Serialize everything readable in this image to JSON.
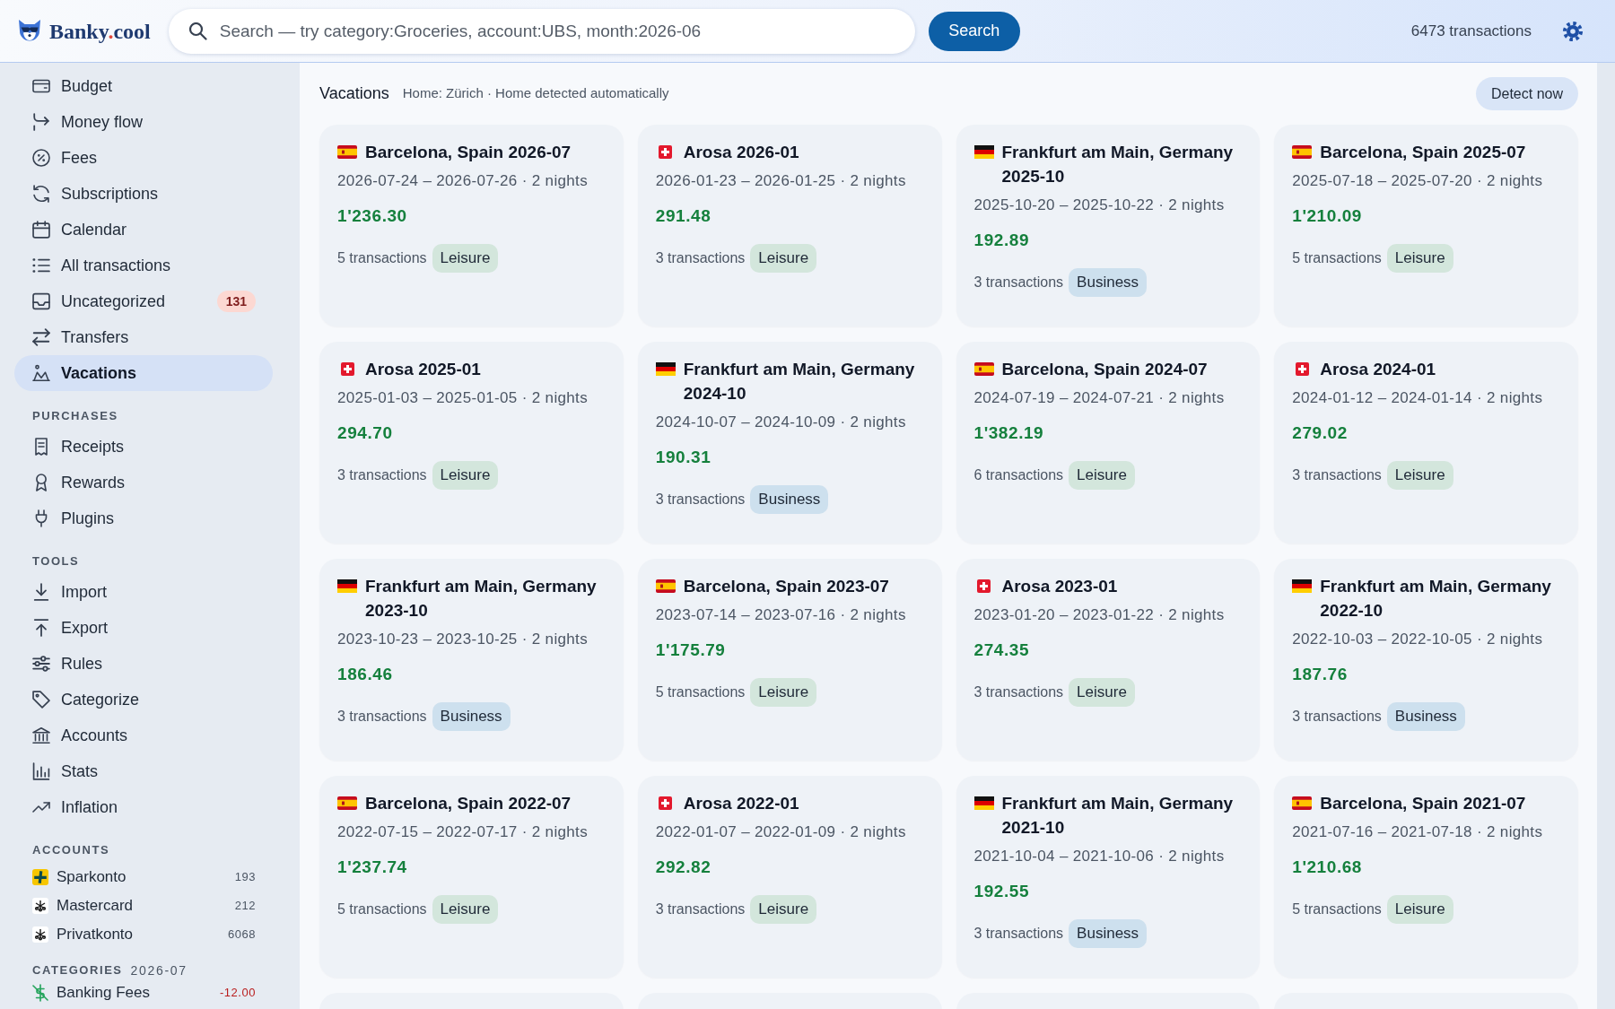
{
  "header": {
    "brand": [
      {
        "text": "Banky",
        "accent": false
      },
      {
        "text": ".",
        "accent": true
      },
      {
        "text": "cool",
        "accent": false
      }
    ],
    "search": {
      "placeholder": "Search — try category:Groceries, account:UBS, month:2026-06"
    },
    "search_button": "Search",
    "transaction_count": "6473 transactions"
  },
  "sidebar": {
    "nav": [
      {
        "label": "Budget",
        "selected": false
      },
      {
        "label": "Money flow",
        "selected": false
      },
      {
        "label": "Fees",
        "selected": false
      },
      {
        "label": "Subscriptions",
        "selected": false
      },
      {
        "label": "Calendar",
        "selected": false
      },
      {
        "label": "All transactions",
        "selected": false
      },
      {
        "label": "Uncategorized",
        "selected": false,
        "badge": "131"
      },
      {
        "label": "Transfers",
        "selected": false
      },
      {
        "label": "Vacations",
        "selected": true
      }
    ],
    "sections": [
      {
        "title": "PURCHASES",
        "items": [
          {
            "label": "Receipts",
            "selected": false
          },
          {
            "label": "Rewards",
            "selected": false
          },
          {
            "label": "Plugins",
            "selected": false
          }
        ]
      },
      {
        "title": "TOOLS",
        "items": [
          {
            "label": "Import",
            "selected": false
          },
          {
            "label": "Export",
            "selected": false
          },
          {
            "label": "Rules",
            "selected": false
          },
          {
            "label": "Categorize",
            "selected": false
          },
          {
            "label": "Accounts",
            "selected": false
          },
          {
            "label": "Stats",
            "selected": false
          },
          {
            "label": "Inflation",
            "selected": false
          }
        ]
      }
    ],
    "accounts": {
      "title": "ACCOUNTS",
      "items": [
        {
          "name": "Sparkonto",
          "count": "193"
        },
        {
          "name": "Mastercard",
          "count": "212"
        },
        {
          "name": "Privatkonto",
          "count": "6068"
        }
      ]
    },
    "categories": {
      "title": "CATEGORIES",
      "period": "2026-07",
      "items": [
        {
          "name": "Banking Fees",
          "amount": "-12.00"
        }
      ]
    }
  },
  "page": {
    "title": "Vacations",
    "subtitle": "Home: Zürich · Home detected automatically",
    "detect_button": "Detect now",
    "cards": [
      {
        "kind": "spain",
        "title": "Barcelona, Spain 2026-07",
        "dates": "2026-07-24 – 2026-07-26 · 2 nights",
        "amount": "1'236.30",
        "transactions": "5 transactions",
        "tag": {
          "label": "Leisure",
          "color": "#d3e6dc"
        }
      },
      {
        "kind": "switzerland",
        "title": "Arosa 2026-01",
        "dates": "2026-01-23 – 2026-01-25 · 2 nights",
        "amount": "291.48",
        "transactions": "3 transactions",
        "tag": {
          "label": "Leisure",
          "color": "#d3e6dc"
        }
      },
      {
        "kind": "germany",
        "title": "Frankfurt am Main, Germany 2025-10",
        "dates": "2025-10-20 – 2025-10-22 · 2 nights",
        "amount": "192.89",
        "transactions": "3 transactions",
        "tag": {
          "label": "Business",
          "color": "#cde0ee"
        }
      },
      {
        "kind": "spain",
        "title": "Barcelona, Spain 2025-07",
        "dates": "2025-07-18 – 2025-07-20 · 2 nights",
        "amount": "1'210.09",
        "transactions": "5 transactions",
        "tag": {
          "label": "Leisure",
          "color": "#d3e6dc"
        }
      },
      {
        "kind": "switzerland",
        "title": "Arosa 2025-01",
        "dates": "2025-01-03 – 2025-01-05 · 2 nights",
        "amount": "294.70",
        "transactions": "3 transactions",
        "tag": {
          "label": "Leisure",
          "color": "#d3e6dc"
        }
      },
      {
        "kind": "germany",
        "title": "Frankfurt am Main, Germany 2024-10",
        "dates": "2024-10-07 – 2024-10-09 · 2 nights",
        "amount": "190.31",
        "transactions": "3 transactions",
        "tag": {
          "label": "Business",
          "color": "#cde0ee"
        }
      },
      {
        "kind": "spain",
        "title": "Barcelona, Spain 2024-07",
        "dates": "2024-07-19 – 2024-07-21 · 2 nights",
        "amount": "1'382.19",
        "transactions": "6 transactions",
        "tag": {
          "label": "Leisure",
          "color": "#d3e6dc"
        }
      },
      {
        "kind": "switzerland",
        "title": "Arosa 2024-01",
        "dates": "2024-01-12 – 2024-01-14 · 2 nights",
        "amount": "279.02",
        "transactions": "3 transactions",
        "tag": {
          "label": "Leisure",
          "color": "#d3e6dc"
        }
      },
      {
        "kind": "germany",
        "title": "Frankfurt am Main, Germany 2023-10",
        "dates": "2023-10-23 – 2023-10-25 · 2 nights",
        "amount": "186.46",
        "transactions": "3 transactions",
        "tag": {
          "label": "Business",
          "color": "#cde0ee"
        }
      },
      {
        "kind": "spain",
        "title": "Barcelona, Spain 2023-07",
        "dates": "2023-07-14 – 2023-07-16 · 2 nights",
        "amount": "1'175.79",
        "transactions": "5 transactions",
        "tag": {
          "label": "Leisure",
          "color": "#d3e6dc"
        }
      },
      {
        "kind": "switzerland",
        "title": "Arosa 2023-01",
        "dates": "2023-01-20 – 2023-01-22 · 2 nights",
        "amount": "274.35",
        "transactions": "3 transactions",
        "tag": {
          "label": "Leisure",
          "color": "#d3e6dc"
        }
      },
      {
        "kind": "germany",
        "title": "Frankfurt am Main, Germany 2022-10",
        "dates": "2022-10-03 – 2022-10-05 · 2 nights",
        "amount": "187.76",
        "transactions": "3 transactions",
        "tag": {
          "label": "Business",
          "color": "#cde0ee"
        }
      },
      {
        "kind": "spain",
        "title": "Barcelona, Spain 2022-07",
        "dates": "2022-07-15 – 2022-07-17 · 2 nights",
        "amount": "1'237.74",
        "transactions": "5 transactions",
        "tag": {
          "label": "Leisure",
          "color": "#d3e6dc"
        }
      },
      {
        "kind": "switzerland",
        "title": "Arosa 2022-01",
        "dates": "2022-01-07 – 2022-01-09 · 2 nights",
        "amount": "292.82",
        "transactions": "3 transactions",
        "tag": {
          "label": "Leisure",
          "color": "#d3e6dc"
        }
      },
      {
        "kind": "germany",
        "title": "Frankfurt am Main, Germany 2021-10",
        "dates": "2021-10-04 – 2021-10-06 · 2 nights",
        "amount": "192.55",
        "transactions": "3 transactions",
        "tag": {
          "label": "Business",
          "color": "#cde0ee"
        }
      },
      {
        "kind": "spain",
        "title": "Barcelona, Spain 2021-07",
        "dates": "2021-07-16 – 2021-07-18 · 2 nights",
        "amount": "1'210.68",
        "transactions": "5 transactions",
        "tag": {
          "label": "Leisure",
          "color": "#d3e6dc"
        }
      }
    ]
  }
}
